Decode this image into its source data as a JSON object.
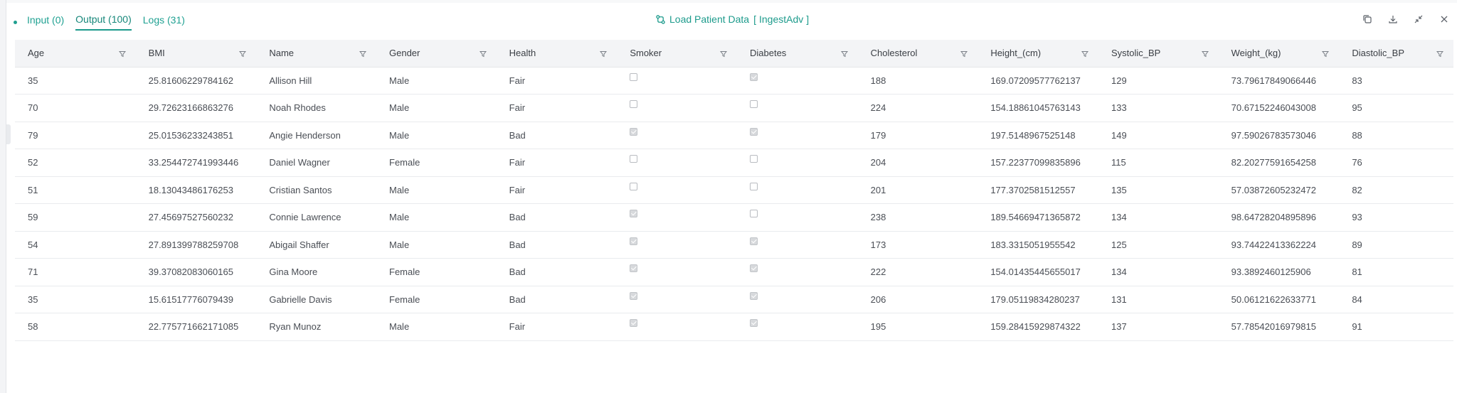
{
  "tabs": [
    {
      "label": "Input (0)",
      "active": false
    },
    {
      "label": "Output (100)",
      "active": true
    },
    {
      "label": "Logs (31)",
      "active": false
    }
  ],
  "title": {
    "name": "Load Patient Data",
    "bracket_open": "[",
    "node": "IngestAdv",
    "bracket_close": "]"
  },
  "actions": [
    "copy-icon",
    "download-icon",
    "collapse-icon",
    "close-icon"
  ],
  "columns": [
    "Age",
    "BMI",
    "Name",
    "Gender",
    "Health",
    "Smoker",
    "Diabetes",
    "Cholesterol",
    "Height_(cm)",
    "Systolic_BP",
    "Weight_(kg)",
    "Diastolic_BP"
  ],
  "rows": [
    {
      "Age": "35",
      "BMI": "25.81606229784162",
      "Name": "Allison Hill",
      "Gender": "Male",
      "Health": "Fair",
      "Smoker": false,
      "Diabetes": true,
      "Cholesterol": "188",
      "Height": "169.07209577762137",
      "Systolic": "129",
      "Weight": "73.79617849066446",
      "Diastolic": "83"
    },
    {
      "Age": "70",
      "BMI": "29.72623166863276",
      "Name": "Noah Rhodes",
      "Gender": "Male",
      "Health": "Fair",
      "Smoker": false,
      "Diabetes": false,
      "Cholesterol": "224",
      "Height": "154.18861045763143",
      "Systolic": "133",
      "Weight": "70.67152246043008",
      "Diastolic": "95"
    },
    {
      "Age": "79",
      "BMI": "25.01536233243851",
      "Name": "Angie Henderson",
      "Gender": "Male",
      "Health": "Bad",
      "Smoker": true,
      "Diabetes": true,
      "Cholesterol": "179",
      "Height": "197.5148967525148",
      "Systolic": "149",
      "Weight": "97.59026783573046",
      "Diastolic": "88"
    },
    {
      "Age": "52",
      "BMI": "33.254472741993446",
      "Name": "Daniel Wagner",
      "Gender": "Female",
      "Health": "Fair",
      "Smoker": false,
      "Diabetes": false,
      "Cholesterol": "204",
      "Height": "157.22377099835896",
      "Systolic": "115",
      "Weight": "82.20277591654258",
      "Diastolic": "76"
    },
    {
      "Age": "51",
      "BMI": "18.13043486176253",
      "Name": "Cristian Santos",
      "Gender": "Male",
      "Health": "Fair",
      "Smoker": false,
      "Diabetes": false,
      "Cholesterol": "201",
      "Height": "177.3702581512557",
      "Systolic": "135",
      "Weight": "57.03872605232472",
      "Diastolic": "82"
    },
    {
      "Age": "59",
      "BMI": "27.45697527560232",
      "Name": "Connie Lawrence",
      "Gender": "Male",
      "Health": "Bad",
      "Smoker": true,
      "Diabetes": false,
      "Cholesterol": "238",
      "Height": "189.54669471365872",
      "Systolic": "134",
      "Weight": "98.64728204895896",
      "Diastolic": "93"
    },
    {
      "Age": "54",
      "BMI": "27.891399788259708",
      "Name": "Abigail Shaffer",
      "Gender": "Male",
      "Health": "Bad",
      "Smoker": true,
      "Diabetes": true,
      "Cholesterol": "173",
      "Height": "183.3315051955542",
      "Systolic": "125",
      "Weight": "93.74422413362224",
      "Diastolic": "89"
    },
    {
      "Age": "71",
      "BMI": "39.37082083060165",
      "Name": "Gina Moore",
      "Gender": "Female",
      "Health": "Bad",
      "Smoker": true,
      "Diabetes": true,
      "Cholesterol": "222",
      "Height": "154.01435445655017",
      "Systolic": "134",
      "Weight": "93.3892460125906",
      "Diastolic": "81"
    },
    {
      "Age": "35",
      "BMI": "15.61517776079439",
      "Name": "Gabrielle Davis",
      "Gender": "Female",
      "Health": "Bad",
      "Smoker": true,
      "Diabetes": true,
      "Cholesterol": "206",
      "Height": "179.05119834280237",
      "Systolic": "131",
      "Weight": "50.06121622633771",
      "Diastolic": "84"
    },
    {
      "Age": "58",
      "BMI": "22.775771662171085",
      "Name": "Ryan Munoz",
      "Gender": "Male",
      "Health": "Fair",
      "Smoker": true,
      "Diabetes": true,
      "Cholesterol": "195",
      "Height": "159.28415929874322",
      "Systolic": "137",
      "Weight": "57.78542016979815",
      "Diastolic": "91"
    }
  ],
  "colors": {
    "accent": "#1b9a8b",
    "header_bg": "#f3f4f6",
    "row_border": "#e9ebee"
  }
}
